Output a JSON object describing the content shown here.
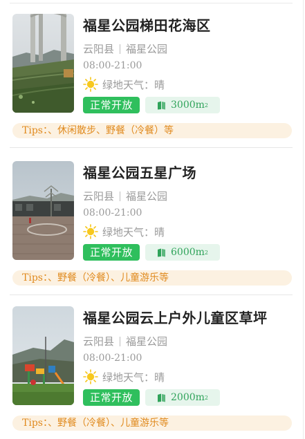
{
  "colors": {
    "open_badge_bg": "#2fbf5d",
    "area_badge_bg": "#e6f5ec",
    "area_badge_text": "#2fa35a",
    "tips_bg": "#fcf1e1",
    "tips_text": "#e08a1e"
  },
  "parks": [
    {
      "title": "福星公园梯田花海区",
      "county": "云阳县",
      "park": "福星公园",
      "hours": "08:00-21:00",
      "weather_label": "绿地天气：",
      "weather_value": "晴",
      "weather_icon": "sun-icon",
      "status": "正常开放",
      "area_icon": "area-icon",
      "area_value": "3000m",
      "area_sup": "2",
      "tips_label": "Tips：",
      "tips_text": "、休闲散步、野餐（冷餐）等"
    },
    {
      "title": "福星公园五星广场",
      "county": "云阳县",
      "park": "福星公园",
      "hours": "08:00-21:00",
      "weather_label": "绿地天气：",
      "weather_value": "晴",
      "weather_icon": "sun-icon",
      "status": "正常开放",
      "area_icon": "area-icon",
      "area_value": "6000m",
      "area_sup": "2",
      "tips_label": "Tips：",
      "tips_text": "、野餐（冷餐）、儿童游乐等"
    },
    {
      "title": "福星公园云上户外儿童区草坪",
      "county": "云阳县",
      "park": "福星公园",
      "hours": "08:00-21:00",
      "weather_label": "绿地天气：",
      "weather_value": "晴",
      "weather_icon": "sun-icon",
      "status": "正常开放",
      "area_icon": "area-icon",
      "area_value": "2000m",
      "area_sup": "2",
      "tips_label": "Tips：",
      "tips_text": "、野餐（冷餐）、儿童游乐等"
    }
  ]
}
